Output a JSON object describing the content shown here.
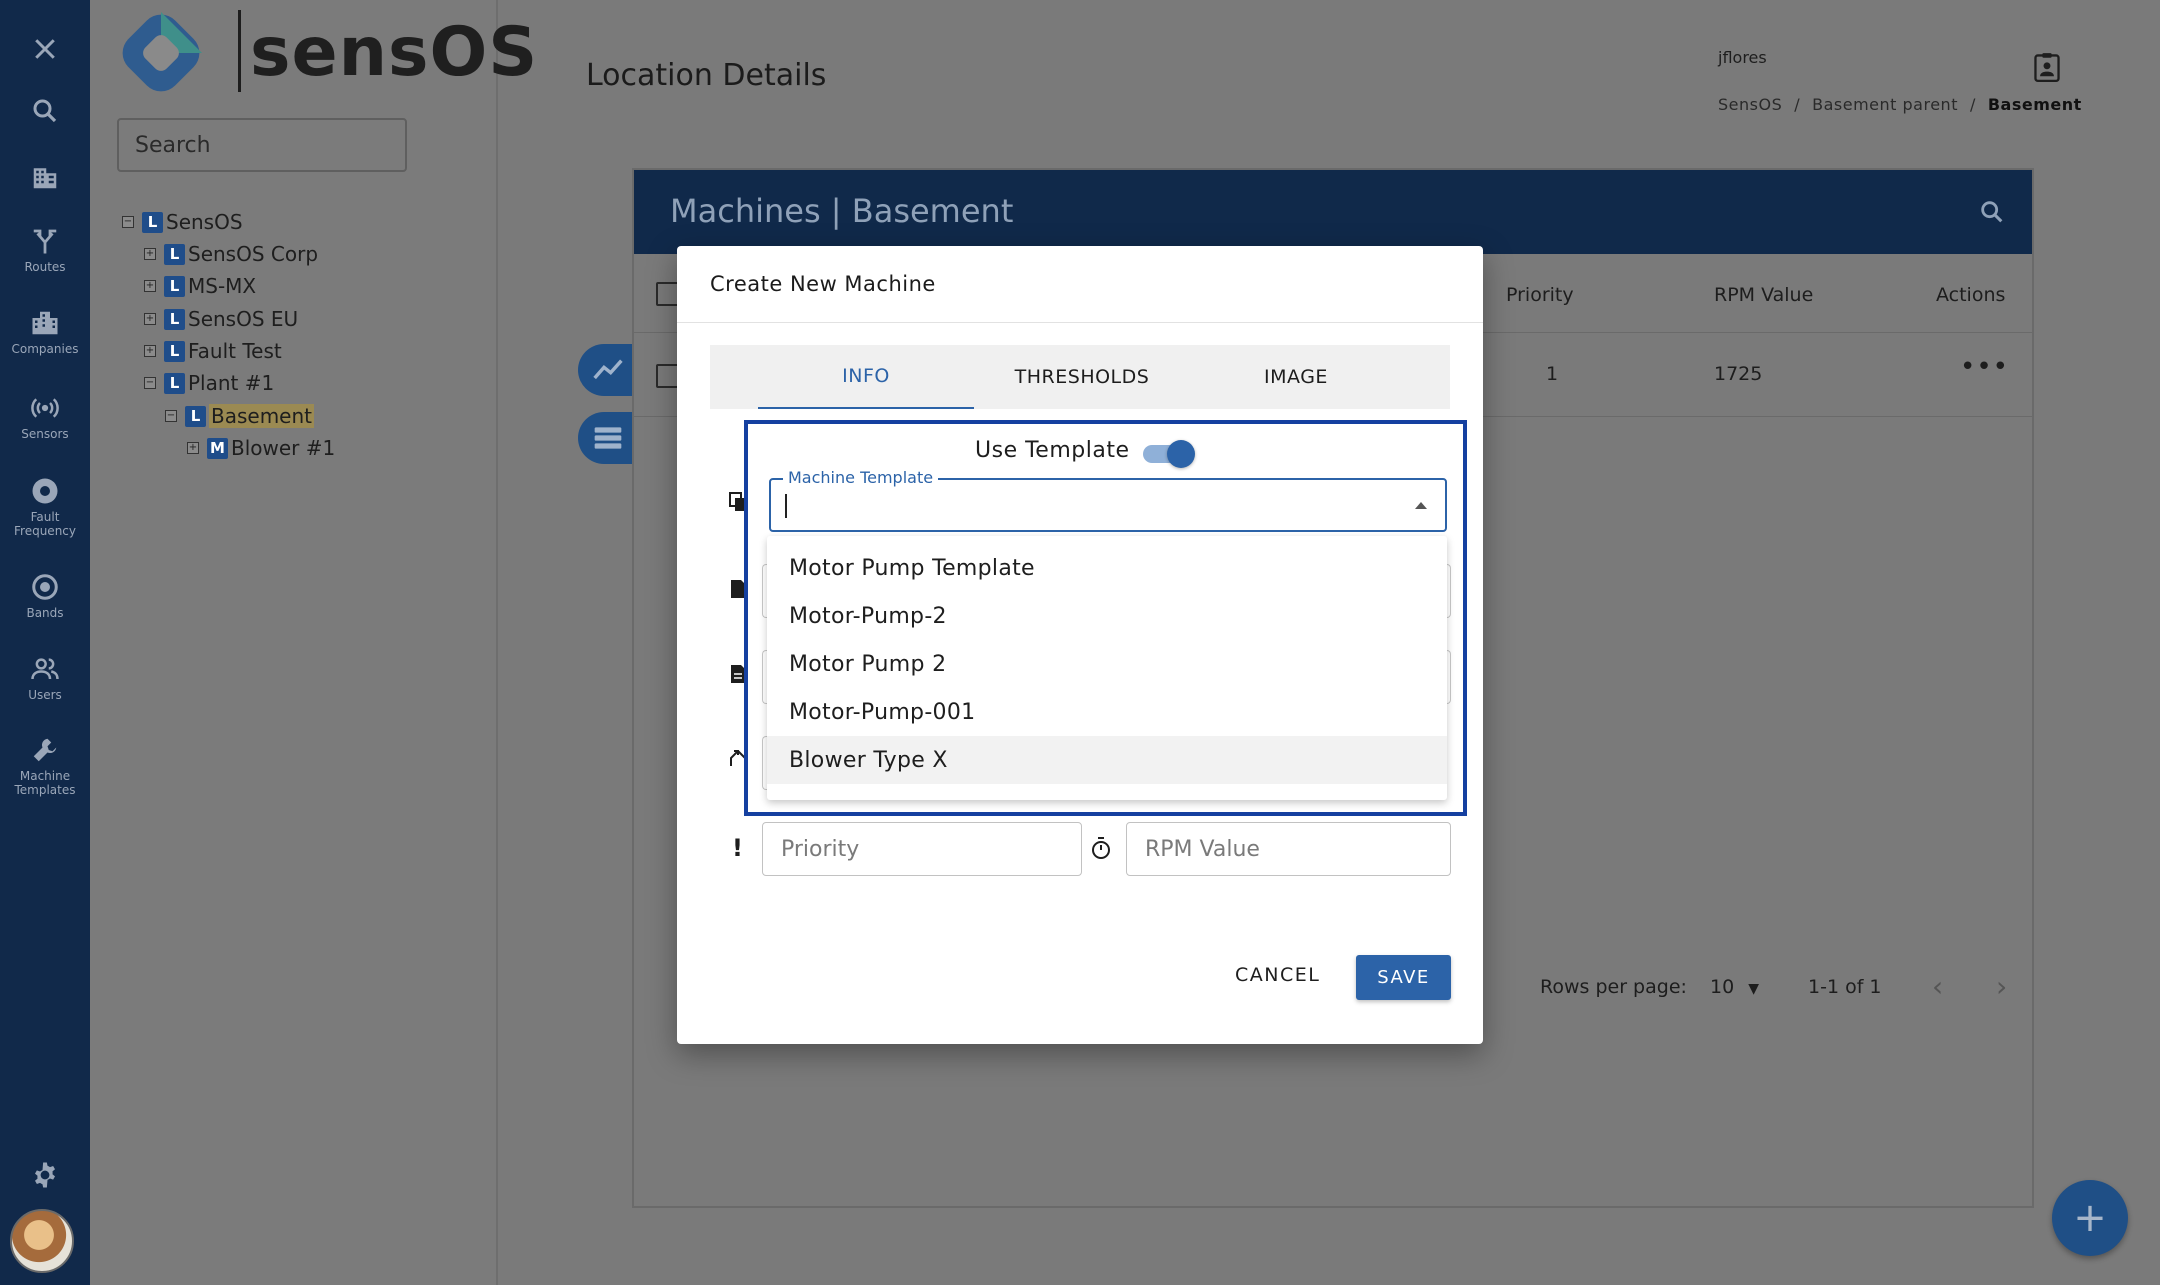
{
  "app": {
    "logo_text": "sensOS"
  },
  "sidebar": {
    "items": [
      {
        "icon": "close-icon",
        "label": ""
      },
      {
        "icon": "search-icon",
        "label": ""
      },
      {
        "icon": "building-icon",
        "label": ""
      },
      {
        "icon": "routes-icon",
        "label": "Routes"
      },
      {
        "icon": "companies-icon",
        "label": "Companies"
      },
      {
        "icon": "sensors-icon",
        "label": "Sensors"
      },
      {
        "icon": "fault-frequency-icon",
        "label": "Fault Frequency"
      },
      {
        "icon": "bands-icon",
        "label": "Bands"
      },
      {
        "icon": "users-icon",
        "label": "Users"
      },
      {
        "icon": "wrench-icon",
        "label": "Machine Templates"
      },
      {
        "icon": "gear-icon",
        "label": ""
      }
    ]
  },
  "tree": {
    "search_placeholder": "Search",
    "nodes": [
      {
        "badge": "L",
        "name": "SensOS",
        "expander": "−"
      },
      {
        "badge": "L",
        "name": "SensOS Corp",
        "expander": "+"
      },
      {
        "badge": "L",
        "name": "MS-MX",
        "expander": "+"
      },
      {
        "badge": "L",
        "name": "SensOS EU",
        "expander": "+"
      },
      {
        "badge": "L",
        "name": "Fault Test",
        "expander": "+"
      },
      {
        "badge": "L",
        "name": "Plant #1",
        "expander": "−"
      },
      {
        "badge": "L",
        "name": "Basement",
        "expander": "−",
        "selected": true
      },
      {
        "badge": "M",
        "name": "Blower #1",
        "expander": "+"
      }
    ]
  },
  "header": {
    "title": "Location Details",
    "user": "jflores",
    "breadcrumb": [
      "SensOS",
      "/",
      "Basement parent",
      "/",
      "Basement"
    ]
  },
  "table": {
    "title": "Machines | Basement",
    "columns": [
      "Priority",
      "RPM Value",
      "Actions"
    ],
    "rows": [
      {
        "priority": "1",
        "rpm": "1725",
        "actions": "•••"
      }
    ],
    "rows_per_page_label": "Rows per page:",
    "rows_per_page": "10",
    "range": "1-1 of 1"
  },
  "modal": {
    "title": "Create New Machine",
    "tabs": [
      "INFO",
      "THRESHOLDS",
      "IMAGE"
    ],
    "active_tab": "INFO",
    "use_template_label": "Use Template",
    "use_template_on": true,
    "template_field_label": "Machine Template",
    "template_value": "",
    "template_options": [
      "Motor Pump Template",
      "Motor-Pump-2",
      "Motor Pump 2",
      "Motor-Pump-001",
      "Blower Type X"
    ],
    "priority_placeholder": "Priority",
    "rpm_placeholder": "RPM Value",
    "cancel_label": "CANCEL",
    "save_label": "SAVE"
  },
  "colors": {
    "primary": "#2c63a8",
    "nav": "#10294a",
    "highlight": "#1540a0"
  }
}
